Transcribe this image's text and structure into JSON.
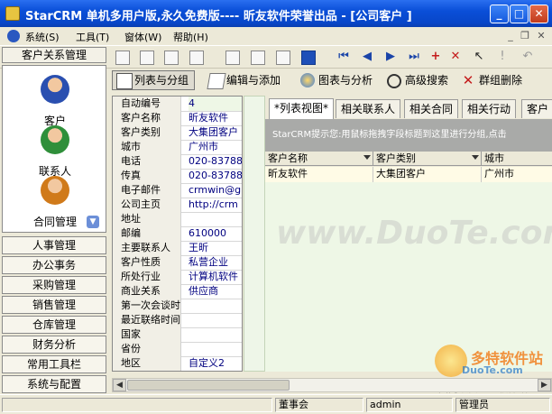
{
  "window": {
    "title": "StarCRM 单机多用户版,永久免费版---- 昕友软件荣誉出品  - [公司客户 ]",
    "minimize": "_",
    "maximize": "□",
    "close": "✕"
  },
  "menu": {
    "items": [
      "系统(S)",
      "工具(T)",
      "窗体(W)",
      "帮助(H)"
    ],
    "mdi_min": "_",
    "mdi_restore": "❐",
    "mdi_close": "✕"
  },
  "nav": {
    "header": "客户关系管理",
    "items": [
      {
        "label": "客户",
        "color": "#2a4fb0"
      },
      {
        "label": "联系人",
        "color": "#2f8f3a"
      },
      {
        "label": "合同管理",
        "color": "#d07a1a"
      }
    ],
    "buttons": [
      "人事管理",
      "办公事务",
      "采购管理",
      "销售管理",
      "仓库管理",
      "财务分析",
      "常用工具栏",
      "系统与配置"
    ]
  },
  "toolbar2": {
    "buttons": [
      "列表与分组",
      "编辑与添加",
      "图表与分析",
      "高级搜索",
      "群组删除"
    ]
  },
  "form": {
    "rows": [
      {
        "label": "自动编号",
        "value": "4"
      },
      {
        "label": "客户名称",
        "value": "昕友软件"
      },
      {
        "label": "客户类别",
        "value": "大集团客户"
      },
      {
        "label": "城市",
        "value": "广州市"
      },
      {
        "label": "电话",
        "value": "020-837883"
      },
      {
        "label": "传真",
        "value": "020-837883"
      },
      {
        "label": "电子邮件",
        "value": "crmwin@gm"
      },
      {
        "label": "公司主页",
        "value": "http://crm"
      },
      {
        "label": "地址",
        "value": ""
      },
      {
        "label": "邮编",
        "value": "610000"
      },
      {
        "label": "主要联系人",
        "value": "王昕"
      },
      {
        "label": "客户性质",
        "value": "私营企业"
      },
      {
        "label": "所处行业",
        "value": "计算机软件"
      },
      {
        "label": "商业关系",
        "value": "供应商"
      },
      {
        "label": "第一次会谈时",
        "value": ""
      },
      {
        "label": "最近联络时间",
        "value": ""
      },
      {
        "label": "国家",
        "value": ""
      },
      {
        "label": "省份",
        "value": ""
      },
      {
        "label": "地区",
        "value": "自定义2"
      }
    ]
  },
  "tabs": [
    "*列表视图*",
    "相关联系人",
    "相关合同",
    "相关行动",
    "客户"
  ],
  "hint": "StarCRM提示您:用鼠标拖拽字段标题到这里进行分组,点击",
  "grid": {
    "columns": [
      "客户名称",
      "客户类别",
      "城市"
    ],
    "rows": [
      [
        "昕友软件",
        "大集团客户",
        "广州市"
      ]
    ]
  },
  "status": {
    "panels": [
      "",
      "董事会",
      "admin",
      "管理员"
    ]
  },
  "watermark": {
    "main": "www.DuoTe.com",
    "logo_text": "多特软件站",
    "logo_url": "DuoTe.com",
    "logo_slogan": "国内最安全的软件站"
  }
}
